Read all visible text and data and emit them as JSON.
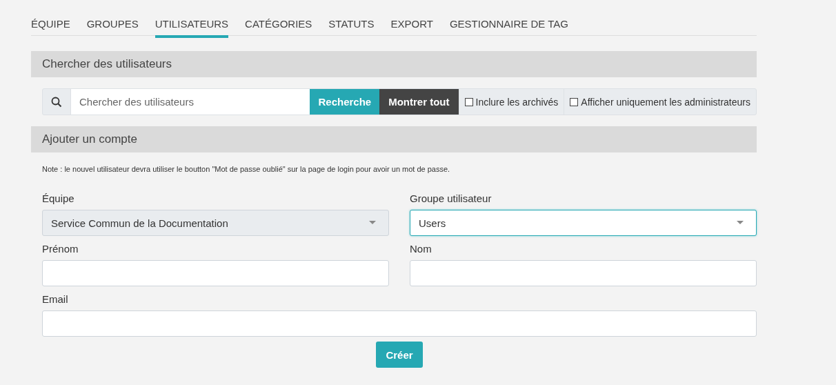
{
  "tabs": [
    {
      "label": "ÉQUIPE",
      "selected": false
    },
    {
      "label": "GROUPES",
      "selected": false
    },
    {
      "label": "UTILISATEURS",
      "selected": true
    },
    {
      "label": "CATÉGORIES",
      "selected": false
    },
    {
      "label": "STATUTS",
      "selected": false
    },
    {
      "label": "EXPORT",
      "selected": false
    },
    {
      "label": "GESTIONNAIRE DE TAG",
      "selected": false
    }
  ],
  "search_section": {
    "title": "Chercher des utilisateurs",
    "search": {
      "placeholder": "Chercher des utilisateurs"
    },
    "search_button": "Recherche",
    "show_all_button": "Montrer tout",
    "options": [
      {
        "label": "Inclure les archivés",
        "checked": false
      },
      {
        "label": "Afficher uniquement les administrateurs",
        "checked": false
      }
    ]
  },
  "add_section": {
    "title": "Ajouter un compte",
    "note": "Note : le nouvel utilisateur devra utiliser le boutton \"Mot de passe oublié\" sur la page de login pour avoir un mot de passe.",
    "selects": [
      {
        "label": "Équipe",
        "value": "Service Commun de la Documentation",
        "disabled": true,
        "focused": false
      },
      {
        "label": "Groupe utilisateur",
        "value": "Users",
        "disabled": false,
        "focused": true
      }
    ],
    "fields": [
      {
        "label": "Prénom"
      },
      {
        "label": "Nom"
      },
      {
        "label": "Email",
        "wide": true
      }
    ],
    "submit": "Créer"
  }
}
